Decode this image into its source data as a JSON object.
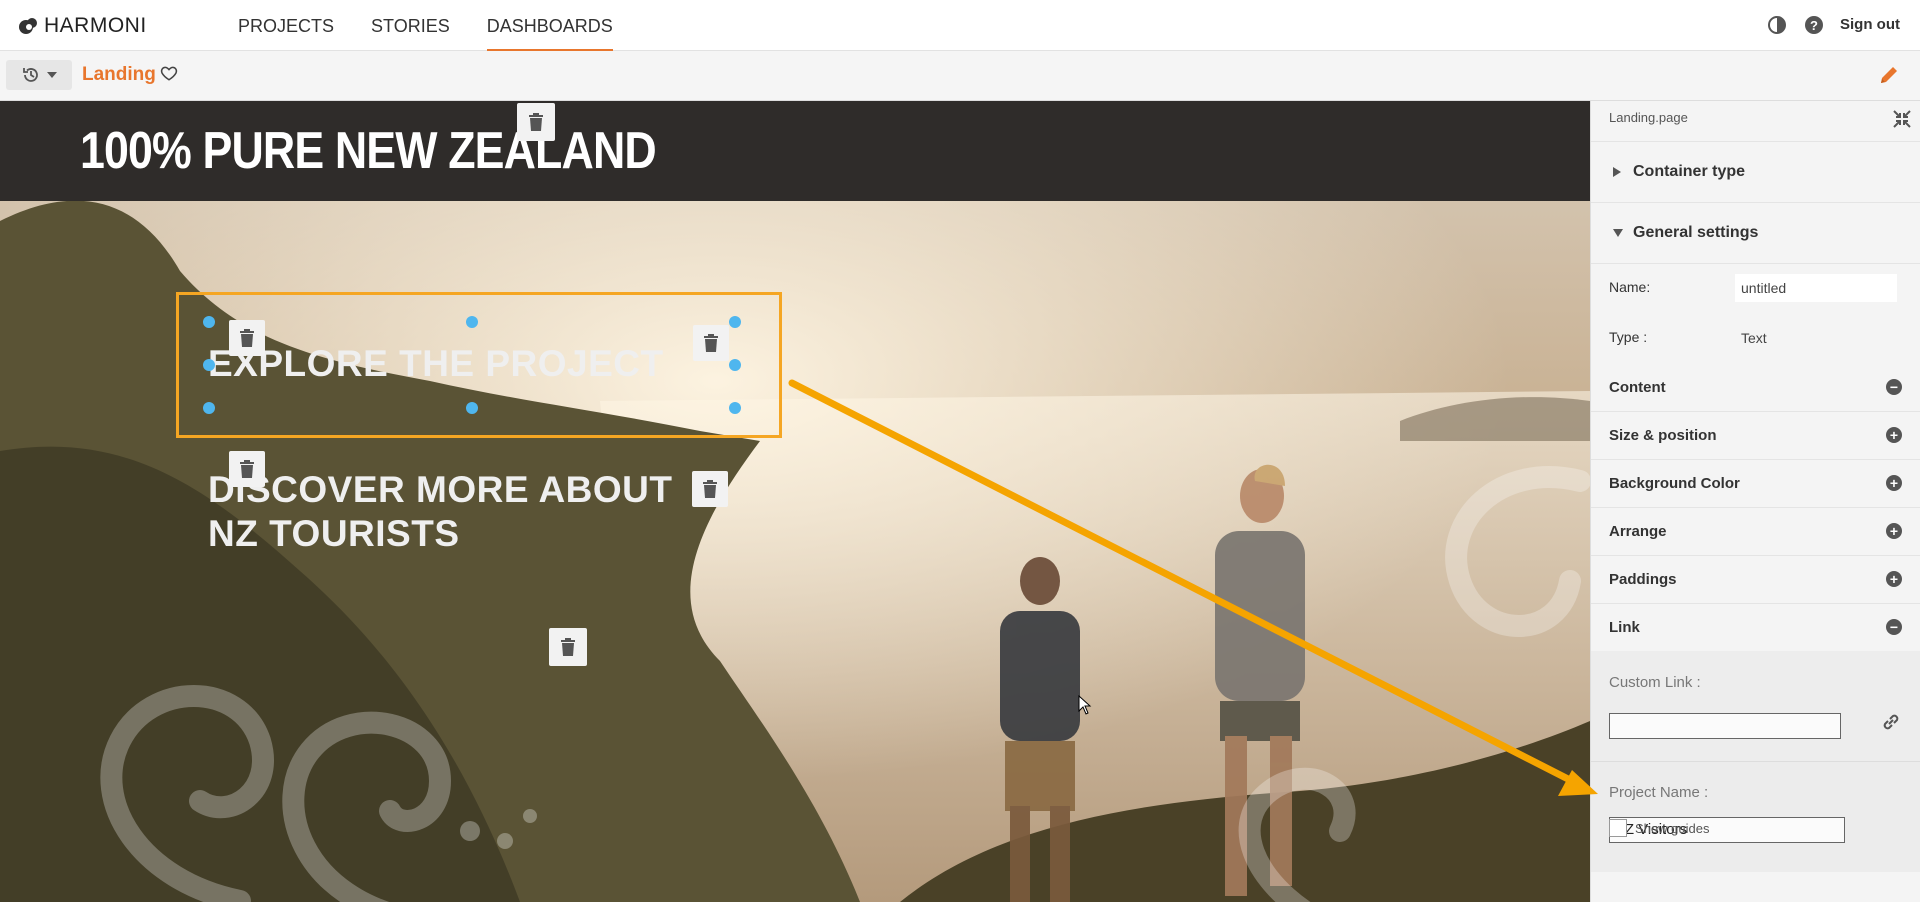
{
  "app": {
    "brand": "HARMONI",
    "nav_tabs": [
      {
        "label": "PROJECTS",
        "active": false
      },
      {
        "label": "STORIES",
        "active": false
      },
      {
        "label": "DASHBOARDS",
        "active": true
      }
    ],
    "sign_out": "Sign out",
    "accent_color": "#e8762d"
  },
  "subbar": {
    "page_name": "Landing"
  },
  "canvas": {
    "banner_title": "100% PURE NEW ZEALAND",
    "heading": "EXPLORE THE PROJECT",
    "subheading_line1": "DISCOVER MORE ABOUT",
    "subheading_line2": "NZ TOURISTS",
    "selection_color": "#f5a623",
    "handle_color": "#4fb6ee"
  },
  "panel": {
    "path": "Landing.page",
    "container_type": "Container type",
    "general_settings": "General settings",
    "name_label": "Name:",
    "name_value": "untitled",
    "type_label": "Type :",
    "type_value": "Text",
    "sections": [
      {
        "label": "Content",
        "state": "expanded"
      },
      {
        "label": "Size & position",
        "state": "collapsed"
      },
      {
        "label": "Background Color",
        "state": "collapsed"
      },
      {
        "label": "Arrange",
        "state": "collapsed"
      },
      {
        "label": "Paddings",
        "state": "collapsed"
      },
      {
        "label": "Link",
        "state": "expanded"
      }
    ],
    "custom_link_label": "Custom Link :",
    "custom_link_value": "",
    "project_name_label": "Project Name :",
    "project_name_value": "NZ Visitors",
    "show_guides": "Show guides"
  }
}
